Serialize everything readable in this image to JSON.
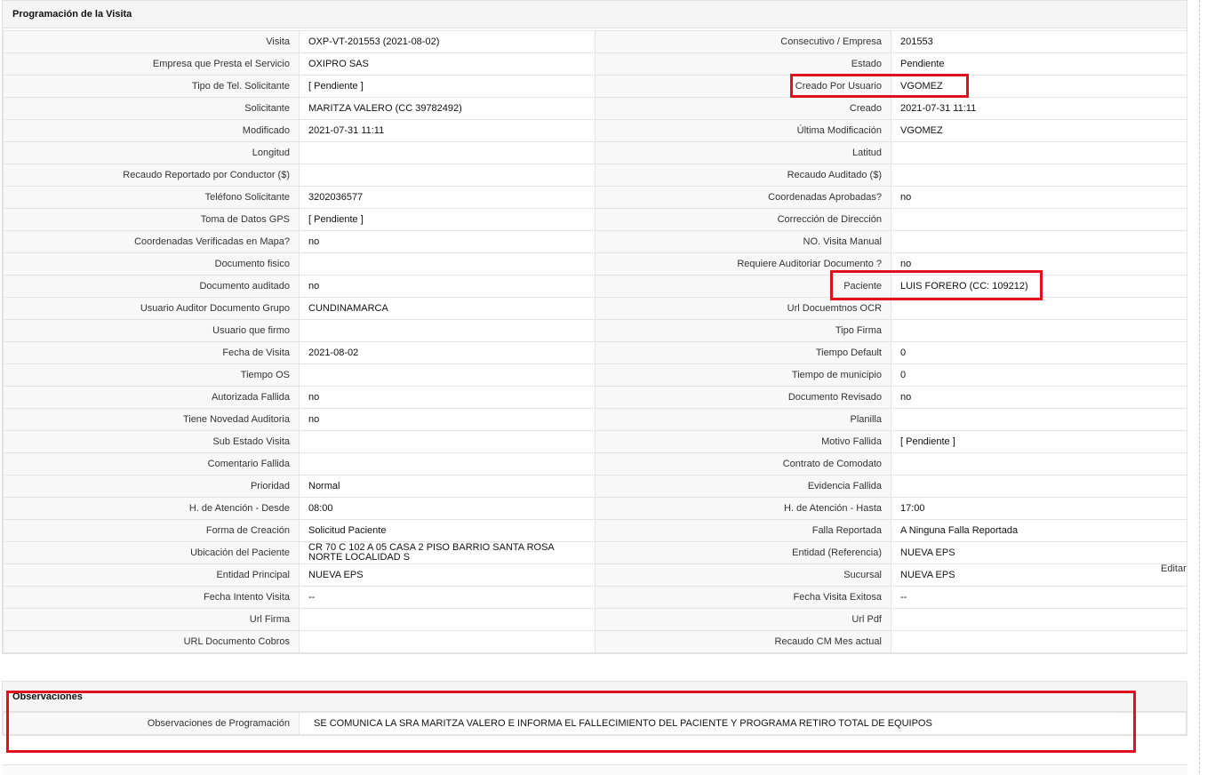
{
  "programacion": {
    "title": "Programación de la Visita",
    "rows": [
      [
        "Visita",
        "OXP-VT-201553 (2021-08-02)",
        "Consecutivo / Empresa",
        "201553"
      ],
      [
        "Empresa que Presta el Servicio",
        "OXIPRO SAS",
        "Estado",
        "Pendiente"
      ],
      [
        "Tipo de Tel. Solicitante",
        "[ Pendiente ]",
        "Creado Por Usuario",
        "VGOMEZ"
      ],
      [
        "Solicitante",
        "MARITZA VALERO (CC 39782492)",
        "Creado",
        "2021-07-31 11:11"
      ],
      [
        "Modificado",
        "2021-07-31 11:11",
        "Última Modificación",
        " VGOMEZ"
      ],
      [
        "Longitud",
        "",
        "Latitud",
        ""
      ],
      [
        "Recaudo Reportado por Conductor ($)",
        "",
        "Recaudo Auditado ($)",
        ""
      ],
      [
        "Teléfono Solicitante",
        "3202036577",
        "Coordenadas Aprobadas?",
        " no"
      ],
      [
        "Toma de Datos GPS",
        "[ Pendiente ]",
        "Corrección de Dirección",
        ""
      ],
      [
        "Coordenadas Verificadas en Mapa?",
        " no",
        "NO. Visita Manual",
        ""
      ],
      [
        "Documento fisico",
        "",
        "Requiere Auditoriar Documento ?",
        " no"
      ],
      [
        "Documento auditado",
        " no",
        "Paciente",
        "LUIS FORERO (CC: 109212)"
      ],
      [
        "Usuario Auditor Documento Grupo",
        "CUNDINAMARCA",
        "Url Docuemtnos OCR",
        ""
      ],
      [
        "Usuario que firmo",
        "",
        "Tipo Firma",
        ""
      ],
      [
        "Fecha de Visita",
        " 2021-08-02",
        "Tiempo Default",
        "0"
      ],
      [
        "Tiempo OS",
        "",
        "Tiempo de municipio",
        "0"
      ],
      [
        "Autorizada Fallida",
        " no",
        "Documento Revisado",
        " no"
      ],
      [
        "Tiene Novedad Auditoria",
        " no",
        "Planilla",
        ""
      ],
      [
        "Sub Estado Visita",
        "",
        "Motivo Fallida",
        "[ Pendiente ]"
      ],
      [
        "Comentario Fallida",
        "",
        "Contrato de Comodato",
        ""
      ],
      [
        "Prioridad",
        "Normal",
        "Evidencia Fallida",
        ""
      ],
      [
        "H. de Atención - Desde",
        "08:00",
        "H. de Atención - Hasta",
        "17:00"
      ],
      [
        "Forma de Creación",
        "Solicitud Paciente",
        "Falla Reportada",
        "A Ninguna Falla Reportada"
      ],
      [
        "Ubicación del Paciente",
        "CR 70 C 102 A 05 CASA 2 PISO BARRIO SANTA ROSA NORTE LOCALIDAD S",
        "Entidad (Referencia)",
        "NUEVA EPS"
      ],
      [
        "Entidad Principal",
        "NUEVA EPS",
        "Sucursal",
        "NUEVA EPS"
      ],
      [
        "Fecha Intento Visita",
        " --",
        "Fecha Visita Exitosa",
        " --"
      ],
      [
        "Url Firma",
        "",
        "Url Pdf",
        ""
      ],
      [
        "URL Documento Cobros",
        "",
        "Recaudo CM Mes actual",
        ""
      ]
    ],
    "editar_link": "Editar"
  },
  "observaciones": {
    "title": "Observaciones",
    "label": "Observaciones de Programación",
    "value": "SE COMUNICA LA SRA MARITZA VALERO E INFORMA EL FALLECIMIENTO DEL PACIENTE Y PROGRAMA RETIRO TOTAL DE EQUIPOS"
  },
  "colors": {
    "highlight": "#e0101c",
    "label_bg": "#f8f8f8",
    "header_bg": "#f5f5f5"
  }
}
